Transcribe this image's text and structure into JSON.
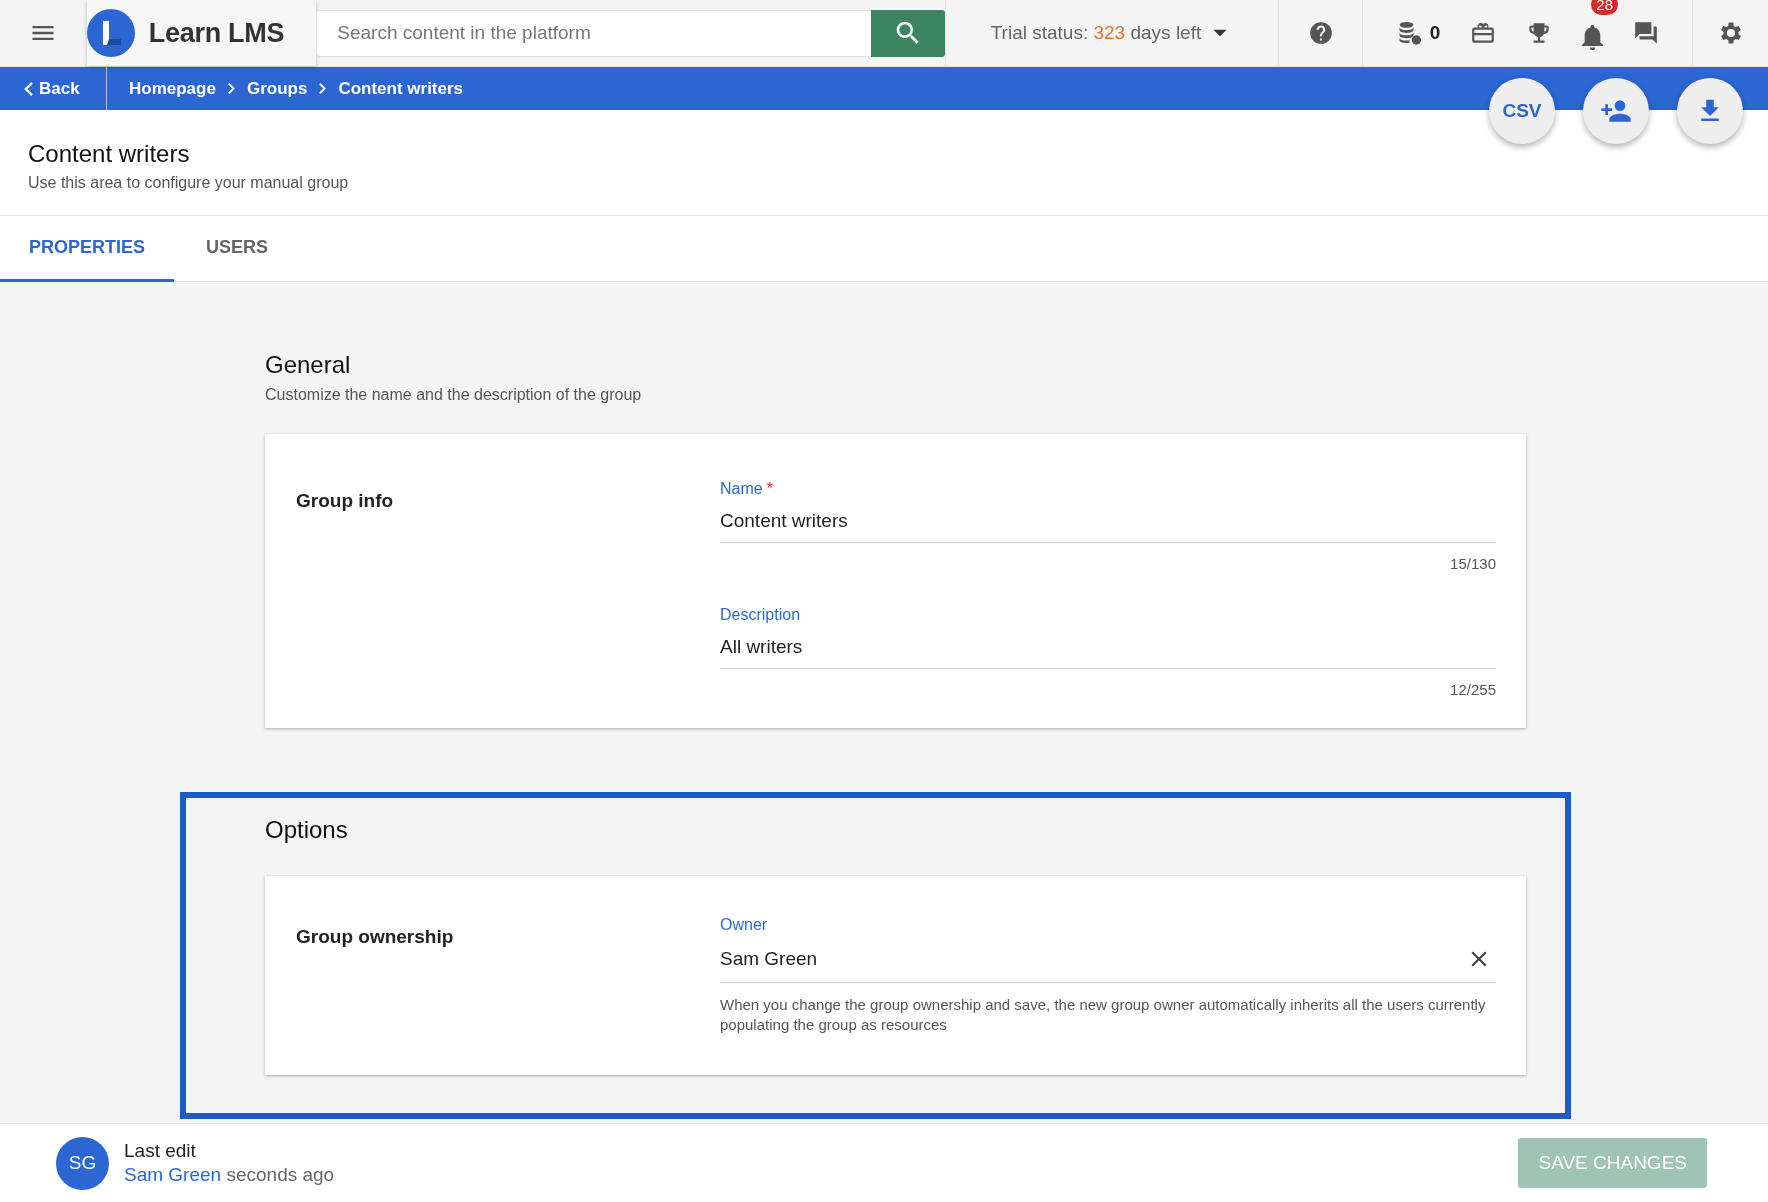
{
  "topbar": {
    "brand": "Learn LMS",
    "search": {
      "placeholder": "Search content in the platform"
    },
    "trial": {
      "label": "Trial status:",
      "days": "323",
      "suffix": "days left"
    },
    "coins": "0",
    "notifications": "28"
  },
  "breadcrumb": {
    "back": "Back",
    "items": [
      "Homepage",
      "Groups",
      "Content writers"
    ]
  },
  "actions": [
    {
      "kind": "csv",
      "label": "CSV"
    },
    {
      "kind": "add-user"
    },
    {
      "kind": "download"
    }
  ],
  "page": {
    "title": "Content writers",
    "subtitle": "Use this area to configure your manual group"
  },
  "tabs": [
    {
      "label": "PROPERTIES",
      "selected": true
    },
    {
      "label": "USERS",
      "selected": false
    }
  ],
  "sections": [
    {
      "title": "General",
      "subtitle": "Customize the name and the description of the group",
      "highlighted": false,
      "card": {
        "label": "Group info",
        "fields": [
          {
            "kind": "text",
            "label": "Name",
            "required_mark": "*",
            "value": "Content writers",
            "counter": "15/130"
          },
          {
            "kind": "text",
            "label": "Description",
            "value": "All writers",
            "counter": "12/255"
          }
        ]
      }
    },
    {
      "title": "Options",
      "highlighted": true,
      "card": {
        "label": "Group ownership",
        "fields": [
          {
            "kind": "select",
            "label": "Owner",
            "value": "Sam Green",
            "clearable": true,
            "hint": "When you change the group ownership and save, the new group owner automatically inherits all the users currently populating the group as resources"
          }
        ]
      }
    }
  ],
  "footer": {
    "avatar": "SG",
    "label": "Last edit",
    "user": "Sam Green",
    "time": "seconds ago",
    "save": {
      "label": "SAVE CHANGES",
      "disabled": true
    }
  }
}
